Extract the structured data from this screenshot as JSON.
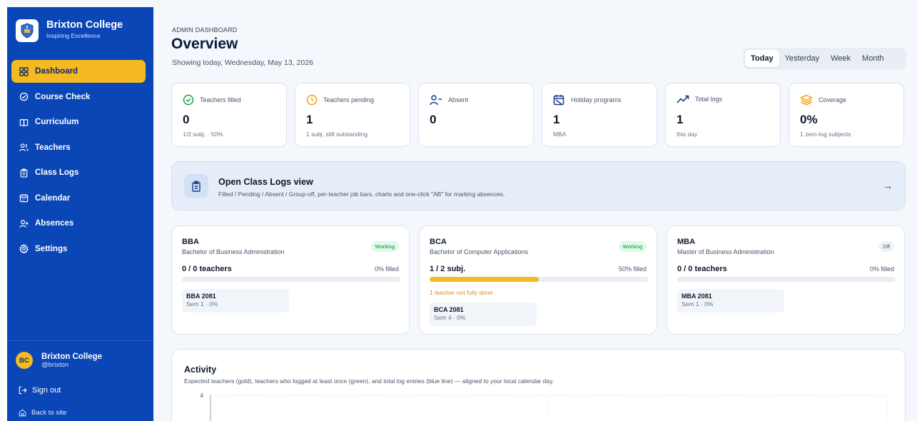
{
  "sidebar": {
    "brand_name": "Brixton College",
    "brand_tagline": "Inspiring Excellence",
    "nav": [
      {
        "label": "Dashboard",
        "icon": "grid-icon",
        "active": true
      },
      {
        "label": "Course Check",
        "icon": "check-circle-icon"
      },
      {
        "label": "Curriculum",
        "icon": "book-icon"
      },
      {
        "label": "Teachers",
        "icon": "users-icon"
      },
      {
        "label": "Class Logs",
        "icon": "clipboard-icon"
      },
      {
        "label": "Calendar",
        "icon": "calendar-icon"
      },
      {
        "label": "Absences",
        "icon": "user-x-icon"
      },
      {
        "label": "Settings",
        "icon": "gear-icon"
      }
    ],
    "user": {
      "initials": "BC",
      "name": "Brixton College",
      "handle": "@brixton"
    },
    "sign_out": "Sign out",
    "back_to_site": "Back to site"
  },
  "header": {
    "eyebrow": "ADMIN DASHBOARD",
    "title": "Overview",
    "subtitle": "Showing today, Wednesday, May 13, 2026",
    "ranges": [
      "Today",
      "Yesterday",
      "Week",
      "Month"
    ],
    "active_range": "Today"
  },
  "stats": [
    {
      "label": "Teachers filled",
      "value": "0",
      "note": "1/2 subj. · 50%",
      "icon": "check-circle-icon",
      "color": "#16a34a"
    },
    {
      "label": "Teachers pending",
      "value": "1",
      "note": "1 subj. still outstanding",
      "icon": "clock-icon",
      "color": "#f59e0b"
    },
    {
      "label": "Absent",
      "value": "0",
      "note": "",
      "icon": "user-minus-icon",
      "color": "#1e3a8a"
    },
    {
      "label": "Holiday programs",
      "value": "1",
      "note": "MBA",
      "icon": "calendar-off-icon",
      "color": "#1e3a8a"
    },
    {
      "label": "Total logs",
      "value": "1",
      "note": "this day",
      "icon": "trend-icon",
      "color": "#1e3a8a"
    },
    {
      "label": "Coverage",
      "value": "0%",
      "note": "1 zero-log subjects",
      "icon": "layers-icon",
      "color": "#f59e0b"
    }
  ],
  "banner": {
    "title": "Open Class Logs view",
    "description": "Filled / Pending / Absent / Group-off, per-teacher job bars, charts and one-click \"AB\" for marking absences."
  },
  "programs": [
    {
      "code": "BBA",
      "name": "Bachelor of Business Administration",
      "status": "Working",
      "count": "0 / 0 teachers",
      "filled": "0% filled",
      "progress": 0,
      "warning": "",
      "batches": [
        {
          "name": "BBA 2081",
          "meta": "Sem 1 · 0%"
        }
      ]
    },
    {
      "code": "BCA",
      "name": "Bachelor of Computer Applications",
      "status": "Working",
      "count": "1 / 2 subj.",
      "filled": "50% filled",
      "progress": 0.5,
      "warning": "1 teacher not fully done",
      "batches": [
        {
          "name": "BCA 2081",
          "meta": "Sem 4 · 0%"
        }
      ]
    },
    {
      "code": "MBA",
      "name": "Master of Business Administration",
      "status": "Off",
      "count": "0 / 0 teachers",
      "filled": "0% filled",
      "progress": 0,
      "warning": "",
      "batches": [
        {
          "name": "MBA 2081",
          "meta": "Sem 1 · 0%"
        }
      ]
    }
  ],
  "activity": {
    "title": "Activity",
    "description": "Expected teachers (gold), teachers who logged at least once (green), and total log entries (blue line) — aligned to your local calendar day.",
    "colors": {
      "expected": "#f5b921",
      "logged": "#16a34a",
      "entries": "#2563eb"
    }
  },
  "chart_data": {
    "type": "bar",
    "title": "Activity",
    "y_tick_labels": [
      "4"
    ],
    "ylim": [
      0,
      4
    ],
    "series": [],
    "grid": true
  }
}
